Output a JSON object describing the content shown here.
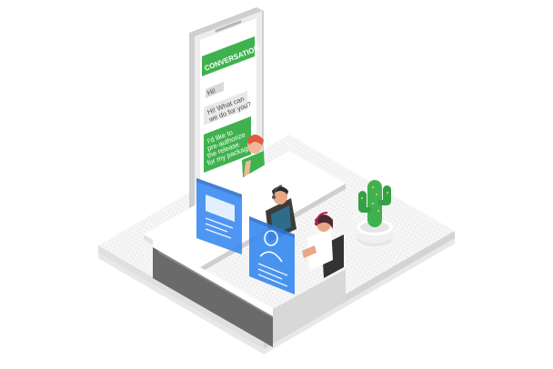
{
  "phone": {
    "header": "CONVERSATION",
    "messages": [
      {
        "from": "customer",
        "text": "Hi!"
      },
      {
        "from": "agent",
        "lines": [
          "Hi! What can",
          "we do for you?"
        ]
      },
      {
        "from": "customer",
        "lines": [
          "I'd like to",
          "pre-authorize",
          "the release",
          "for my package."
        ]
      }
    ]
  },
  "colors": {
    "accent_green": "#3fb24f",
    "panel_blue": "#3b8bf0",
    "platform": "#f2f2f2",
    "phone_body": "#e6e6e6"
  }
}
